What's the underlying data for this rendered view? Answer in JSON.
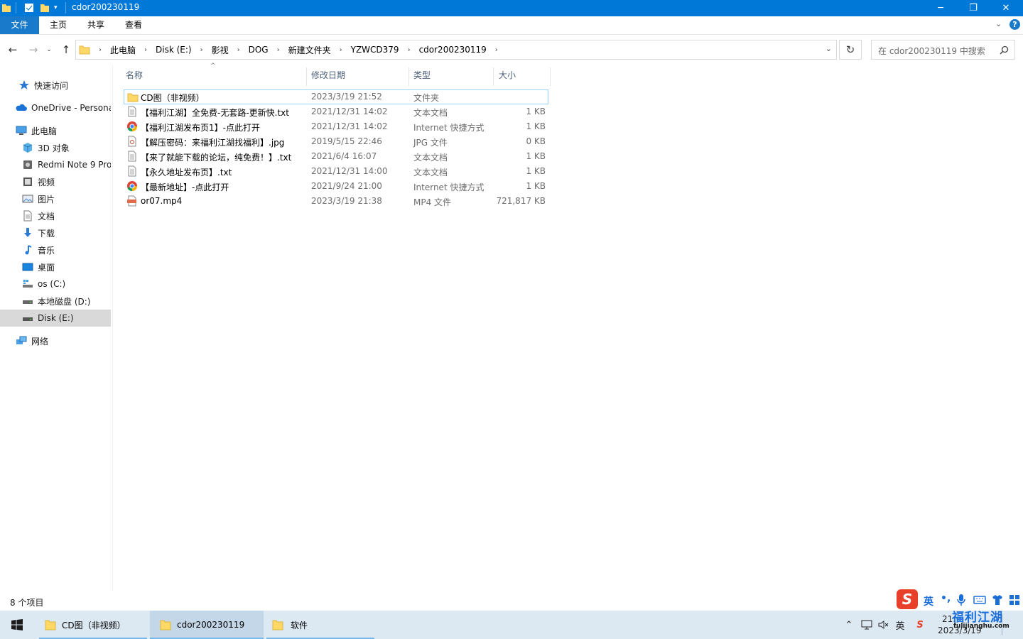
{
  "window": {
    "title": "cdor200230119",
    "controls": {
      "minimize": "─",
      "maximize": "❐",
      "close": "✕"
    }
  },
  "ribbon": {
    "tabs": [
      "文件",
      "主页",
      "共享",
      "查看"
    ],
    "expand_icon": "chevron-down-icon",
    "help_label": "?"
  },
  "address": {
    "crumbs": [
      "此电脑",
      "Disk (E:)",
      "影视",
      "DOG",
      "新建文件夹",
      "YZWCD379",
      "cdor200230119"
    ],
    "search_placeholder": "在 cdor200230119 中搜索"
  },
  "nav": {
    "items": [
      {
        "label": "快速访问",
        "icon": "star-icon"
      },
      {
        "label": "OneDrive - Persona",
        "icon": "cloud-icon"
      },
      {
        "label": "此电脑",
        "icon": "computer-icon"
      },
      {
        "label": "3D 对象",
        "icon": "cube-icon"
      },
      {
        "label": "Redmi Note 9 Pro",
        "icon": "phone-icon"
      },
      {
        "label": "视频",
        "icon": "video-icon"
      },
      {
        "label": "图片",
        "icon": "picture-icon"
      },
      {
        "label": "文档",
        "icon": "document-icon"
      },
      {
        "label": "下载",
        "icon": "download-icon"
      },
      {
        "label": "音乐",
        "icon": "music-icon"
      },
      {
        "label": "桌面",
        "icon": "desktop-icon"
      },
      {
        "label": "os (C:)",
        "icon": "drive-icon"
      },
      {
        "label": "本地磁盘 (D:)",
        "icon": "drive-icon"
      },
      {
        "label": "Disk (E:)",
        "icon": "drive-icon"
      },
      {
        "label": "网络",
        "icon": "network-icon"
      }
    ]
  },
  "files": {
    "columns": {
      "name": "名称",
      "date": "修改日期",
      "type": "类型",
      "size": "大小"
    },
    "rows": [
      {
        "name": "CD图（非视频）",
        "date": "2023/3/19 21:52",
        "type": "文件夹",
        "size": "",
        "icon": "folder-icon"
      },
      {
        "name": "【福利江湖】全免费-无套路-更新快.txt",
        "date": "2021/12/31 14:02",
        "type": "文本文档",
        "size": "1 KB",
        "icon": "text-file-icon"
      },
      {
        "name": "【福利江湖发布页1】-点此打开",
        "date": "2021/12/31 14:02",
        "type": "Internet 快捷方式",
        "size": "1 KB",
        "icon": "chrome-icon"
      },
      {
        "name": "【解压密码：来福利江湖找福利】.jpg",
        "date": "2019/5/15 22:46",
        "type": "JPG 文件",
        "size": "0 KB",
        "icon": "image-file-icon"
      },
      {
        "name": "【来了就能下载的论坛，纯免费！】.txt",
        "date": "2021/6/4 16:07",
        "type": "文本文档",
        "size": "1 KB",
        "icon": "text-file-icon"
      },
      {
        "name": "【永久地址发布页】.txt",
        "date": "2021/12/31 14:00",
        "type": "文本文档",
        "size": "1 KB",
        "icon": "text-file-icon"
      },
      {
        "name": "【最新地址】-点此打开",
        "date": "2021/9/24 21:00",
        "type": "Internet 快捷方式",
        "size": "1 KB",
        "icon": "chrome-icon"
      },
      {
        "name": "or07.mp4",
        "date": "2023/3/19 21:38",
        "type": "MP4 文件",
        "size": "721,817 KB",
        "icon": "video-file-icon"
      }
    ]
  },
  "status": {
    "item_count": "8 个项目"
  },
  "taskbar": {
    "windows": [
      {
        "label": "CD图（非视频）"
      },
      {
        "label": "cdor200230119"
      },
      {
        "label": "软件"
      }
    ],
    "ime": {
      "lang": "英",
      "punct": "•,",
      "logo": "S"
    },
    "clock": {
      "time": "21:",
      "date": "2023/3/19"
    },
    "watermark": {
      "text": "福利江湖",
      "url": "fulijianghu.com"
    }
  },
  "colors": {
    "titlebar": "#0078d7",
    "accent": "#1979ca",
    "selection": "#cce8ff",
    "taskbar": "#dce8f2"
  }
}
